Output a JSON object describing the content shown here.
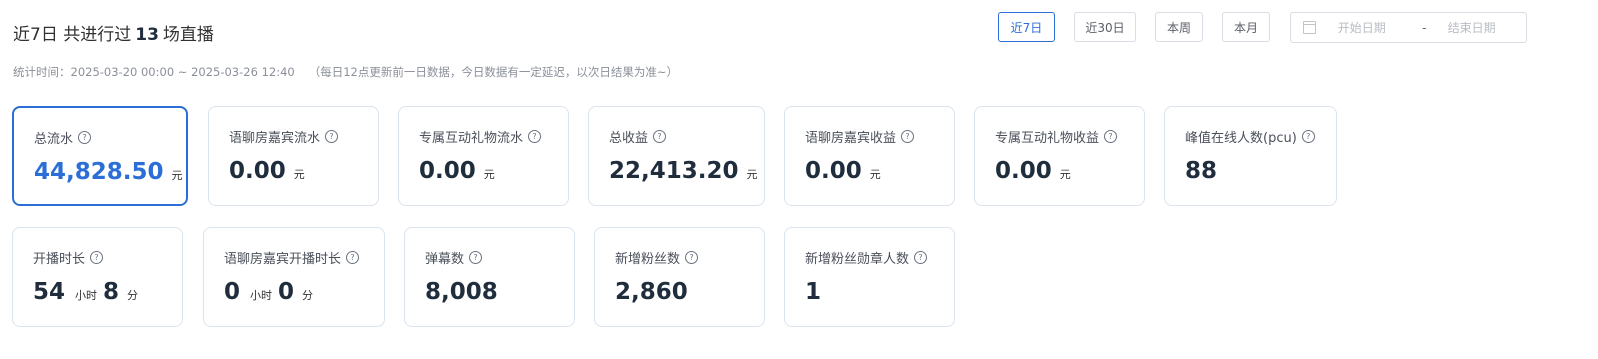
{
  "header": {
    "title_prefix": "近7日 共进行过",
    "title_count": "13",
    "title_suffix": "场直播",
    "stat_time_label": "统计时间：",
    "stat_time_range": "2025-03-20 00:00 ~ 2025-03-26 12:40",
    "note": "（每日12点更新前一日数据，今日数据有一定延迟，以次日结果为准~）"
  },
  "filters": {
    "buttons": [
      "近7日",
      "近30日",
      "本周",
      "本月"
    ],
    "active": "近7日",
    "date_start_placeholder": "开始日期",
    "date_separator": "-",
    "date_end_placeholder": "结束日期"
  },
  "metrics_row1": [
    {
      "label": "总流水",
      "value": "44,828.50",
      "unit": "元"
    },
    {
      "label": "语聊房嘉宾流水",
      "value": "0.00",
      "unit": "元"
    },
    {
      "label": "专属互动礼物流水",
      "value": "0.00",
      "unit": "元"
    },
    {
      "label": "总收益",
      "value": "22,413.20",
      "unit": "元"
    },
    {
      "label": "语聊房嘉宾收益",
      "value": "0.00",
      "unit": "元"
    },
    {
      "label": "专属互动礼物收益",
      "value": "0.00",
      "unit": "元"
    },
    {
      "label": "峰值在线人数(pcu)",
      "value": "88"
    }
  ],
  "metrics_row2": [
    {
      "label": "开播时长",
      "hours": "54",
      "hours_unit": "小时",
      "minutes": "8",
      "minutes_unit": "分"
    },
    {
      "label": "语聊房嘉宾开播时长",
      "hours": "0",
      "hours_unit": "小时",
      "minutes": "0",
      "minutes_unit": "分"
    },
    {
      "label": "弹幕数",
      "value": "8,008"
    },
    {
      "label": "新增粉丝数",
      "value": "2,860"
    },
    {
      "label": "新增粉丝勋章人数",
      "value": "1"
    }
  ],
  "help_icon_glyph": "?"
}
